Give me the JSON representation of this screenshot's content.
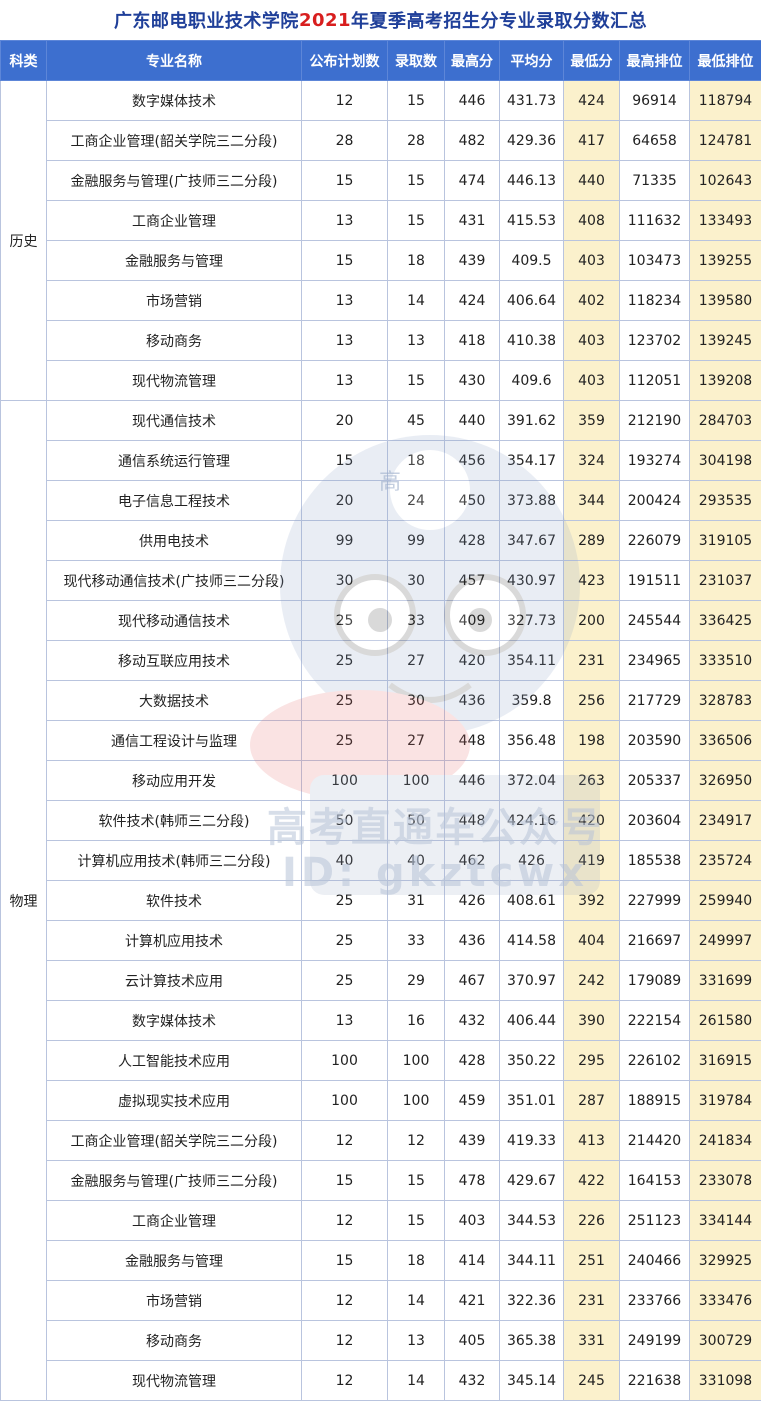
{
  "title": {
    "prefix": "广东邮电职业技术学院",
    "year": "2021",
    "suffix": "年夏季高考招生分专业录取分数汇总"
  },
  "headers": [
    "科类",
    "专业名称",
    "公布计划数",
    "录取数",
    "最高分",
    "平均分",
    "最低分",
    "最高排位",
    "最低排位"
  ],
  "watermark": {
    "line1": "高考直通车公众号",
    "line2": "ID: gkztcwx",
    "badge": "高"
  },
  "colors": {
    "header_bg": "#3d6fcf",
    "title": "#1f3f99",
    "year": "#d81e1e",
    "highlight": "#fbf1cc"
  },
  "groups": [
    {
      "category": "历史",
      "rows": [
        [
          "数字媒体技术",
          "12",
          "15",
          "446",
          "431.73",
          "424",
          "96914",
          "118794"
        ],
        [
          "工商企业管理(韶关学院三二分段)",
          "28",
          "28",
          "482",
          "429.36",
          "417",
          "64658",
          "124781"
        ],
        [
          "金融服务与管理(广技师三二分段)",
          "15",
          "15",
          "474",
          "446.13",
          "440",
          "71335",
          "102643"
        ],
        [
          "工商企业管理",
          "13",
          "15",
          "431",
          "415.53",
          "408",
          "111632",
          "133493"
        ],
        [
          "金融服务与管理",
          "15",
          "18",
          "439",
          "409.5",
          "403",
          "103473",
          "139255"
        ],
        [
          "市场营销",
          "13",
          "14",
          "424",
          "406.64",
          "402",
          "118234",
          "139580"
        ],
        [
          "移动商务",
          "13",
          "13",
          "418",
          "410.38",
          "403",
          "123702",
          "139245"
        ],
        [
          "现代物流管理",
          "13",
          "15",
          "430",
          "409.6",
          "403",
          "112051",
          "139208"
        ]
      ]
    },
    {
      "category": "物理",
      "rows": [
        [
          "现代通信技术",
          "20",
          "45",
          "440",
          "391.62",
          "359",
          "212190",
          "284703"
        ],
        [
          "通信系统运行管理",
          "15",
          "18",
          "456",
          "354.17",
          "324",
          "193274",
          "304198"
        ],
        [
          "电子信息工程技术",
          "20",
          "24",
          "450",
          "373.88",
          "344",
          "200424",
          "293535"
        ],
        [
          "供用电技术",
          "99",
          "99",
          "428",
          "347.67",
          "289",
          "226079",
          "319105"
        ],
        [
          "现代移动通信技术(广技师三二分段)",
          "30",
          "30",
          "457",
          "430.97",
          "423",
          "191511",
          "231037"
        ],
        [
          "现代移动通信技术",
          "25",
          "33",
          "409",
          "327.73",
          "200",
          "245544",
          "336425"
        ],
        [
          "移动互联应用技术",
          "25",
          "27",
          "420",
          "354.11",
          "231",
          "234965",
          "333510"
        ],
        [
          "大数据技术",
          "25",
          "30",
          "436",
          "359.8",
          "256",
          "217729",
          "328783"
        ],
        [
          "通信工程设计与监理",
          "25",
          "27",
          "448",
          "356.48",
          "198",
          "203590",
          "336506"
        ],
        [
          "移动应用开发",
          "100",
          "100",
          "446",
          "372.04",
          "263",
          "205337",
          "326950"
        ],
        [
          "软件技术(韩师三二分段)",
          "50",
          "50",
          "448",
          "424.16",
          "420",
          "203604",
          "234917"
        ],
        [
          "计算机应用技术(韩师三二分段)",
          "40",
          "40",
          "462",
          "426",
          "419",
          "185538",
          "235724"
        ],
        [
          "软件技术",
          "25",
          "31",
          "426",
          "408.61",
          "392",
          "227999",
          "259940"
        ],
        [
          "计算机应用技术",
          "25",
          "33",
          "436",
          "414.58",
          "404",
          "216697",
          "249997"
        ],
        [
          "云计算技术应用",
          "25",
          "29",
          "467",
          "370.97",
          "242",
          "179089",
          "331699"
        ],
        [
          "数字媒体技术",
          "13",
          "16",
          "432",
          "406.44",
          "390",
          "222154",
          "261580"
        ],
        [
          "人工智能技术应用",
          "100",
          "100",
          "428",
          "350.22",
          "295",
          "226102",
          "316915"
        ],
        [
          "虚拟现实技术应用",
          "100",
          "100",
          "459",
          "351.01",
          "287",
          "188915",
          "319784"
        ],
        [
          "工商企业管理(韶关学院三二分段)",
          "12",
          "12",
          "439",
          "419.33",
          "413",
          "214420",
          "241834"
        ],
        [
          "金融服务与管理(广技师三二分段)",
          "15",
          "15",
          "478",
          "429.67",
          "422",
          "164153",
          "233078"
        ],
        [
          "工商企业管理",
          "12",
          "15",
          "403",
          "344.53",
          "226",
          "251123",
          "334144"
        ],
        [
          "金融服务与管理",
          "15",
          "18",
          "414",
          "344.11",
          "251",
          "240466",
          "329925"
        ],
        [
          "市场营销",
          "12",
          "14",
          "421",
          "322.36",
          "231",
          "233766",
          "333476"
        ],
        [
          "移动商务",
          "12",
          "13",
          "405",
          "365.38",
          "331",
          "249199",
          "300729"
        ],
        [
          "现代物流管理",
          "12",
          "14",
          "432",
          "345.14",
          "245",
          "221638",
          "331098"
        ]
      ]
    }
  ]
}
